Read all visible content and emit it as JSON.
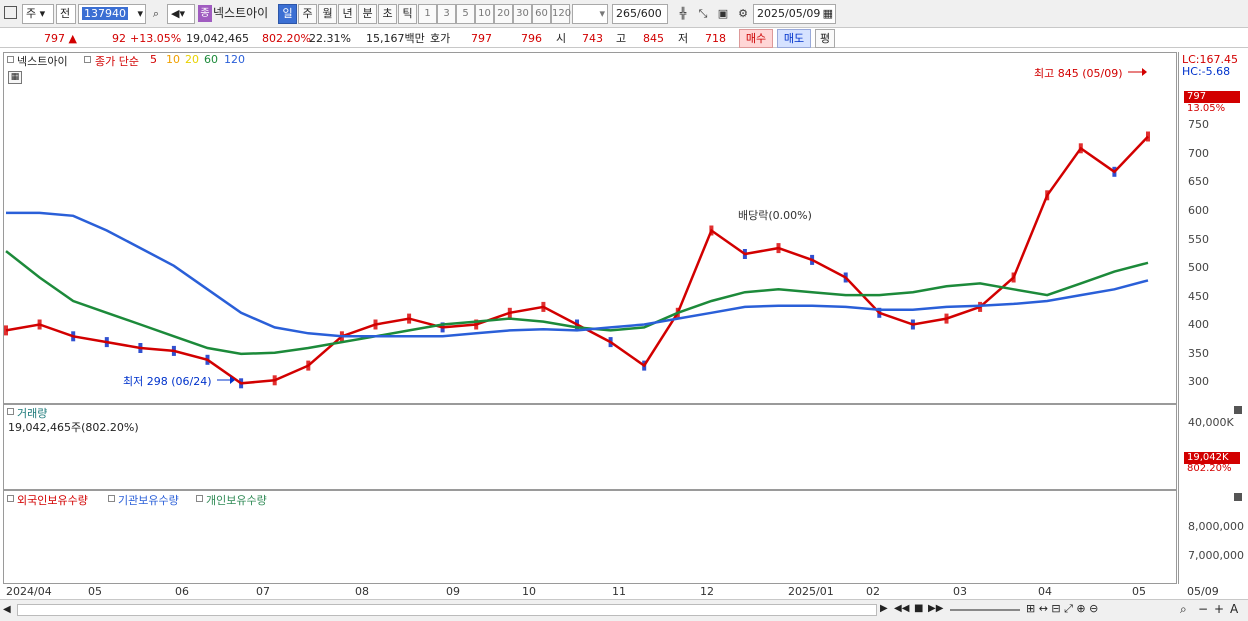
{
  "toolbar": {
    "market_select": "주",
    "range_select": "전",
    "code": "137940",
    "stock_badge": "종",
    "stock_name": "넥스트아이",
    "periods": [
      "일",
      "주",
      "월",
      "년",
      "분",
      "초",
      "틱"
    ],
    "selected_period": "일",
    "intervals": [
      "1",
      "3",
      "5",
      "10",
      "20",
      "30",
      "60",
      "120"
    ],
    "count_value": "265",
    "count_total": "/600",
    "date": "2025/05/09"
  },
  "quote": {
    "price": "797",
    "change_arrow": "▲",
    "change": "92",
    "change_pct": "+13.05%",
    "volume": "19,042,465",
    "volume_pct": "802.20%",
    "turnover_pct": "22.31%",
    "amount": "15,167백만",
    "hoga_label": "호가",
    "ask": "797",
    "bid": "796",
    "open_label": "시",
    "open": "743",
    "high_label": "고",
    "high": "845",
    "low_label": "저",
    "low": "718",
    "buy_label": "매수",
    "sell_label": "매도",
    "avg_label": "평"
  },
  "price_pane": {
    "name": "넥스트아이",
    "ma_title": "종가 단순",
    "ma_periods": [
      "5",
      "10",
      "20",
      "60",
      "120"
    ],
    "ma_colors": [
      "#d20000",
      "#f0a000",
      "#ffe600",
      "#1c8a3a",
      "#2a5fd8"
    ],
    "lc_label": "LC:167.45",
    "hc_label": "HC:-5.68",
    "high_note": "최고 845 (05/09)",
    "low_note": "최저 298 (06/24)",
    "dividend_note": "배당락(0.00%)",
    "current_price_tag": "797",
    "current_pct": "13.05%",
    "y_ticks": [
      "750",
      "700",
      "650",
      "600",
      "550",
      "500",
      "450",
      "400",
      "350",
      "300"
    ]
  },
  "volume_pane": {
    "title": "거래량",
    "summary": "19,042,465주(802.20%)",
    "axis_label": "40,000K",
    "last_tag": "19,042K",
    "last_pct": "802.20%"
  },
  "holding_pane": {
    "legend": [
      "외국인보유수량",
      "기관보유수량",
      "개인보유수량"
    ],
    "colors": [
      "#d20000",
      "#2a5fd8",
      "#2f8a55"
    ],
    "y_ticks": [
      "8,000,000",
      "7,000,000"
    ]
  },
  "x_axis": {
    "labels": [
      "2024/04",
      "05",
      "06",
      "07",
      "08",
      "09",
      "10",
      "11",
      "12",
      "2025/01",
      "02",
      "03",
      "04",
      "05"
    ],
    "right_label": "05/09"
  },
  "chart_data": {
    "type": "line",
    "title": "",
    "ohlc_latest": {
      "open": 743,
      "high": 845,
      "low": 718,
      "close": 797
    },
    "period_high": {
      "value": 845,
      "date": "05/09"
    },
    "period_low": {
      "value": 298,
      "date": "06/24"
    },
    "ylim": [
      280,
      840
    ],
    "series": [
      {
        "name": "5",
        "values": [
          390,
          400,
          380,
          370,
          360,
          355,
          340,
          300,
          305,
          330,
          380,
          400,
          410,
          395,
          400,
          420,
          430,
          400,
          370,
          330,
          420,
          560,
          520,
          530,
          510,
          480,
          420,
          400,
          410,
          430,
          480,
          620,
          700,
          660,
          720
        ]
      },
      {
        "name": "60",
        "values": [
          525,
          480,
          440,
          420,
          400,
          380,
          360,
          350,
          352,
          360,
          370,
          380,
          390,
          400,
          405,
          410,
          405,
          395,
          390,
          395,
          420,
          440,
          455,
          460,
          455,
          450,
          450,
          455,
          465,
          470,
          460,
          450,
          470,
          490,
          505
        ]
      },
      {
        "name": "120",
        "values": [
          590,
          590,
          585,
          560,
          530,
          500,
          460,
          420,
          395,
          385,
          380,
          380,
          380,
          380,
          385,
          390,
          392,
          390,
          395,
          400,
          410,
          420,
          430,
          432,
          432,
          430,
          425,
          425,
          430,
          432,
          435,
          440,
          450,
          460,
          475
        ]
      }
    ]
  }
}
